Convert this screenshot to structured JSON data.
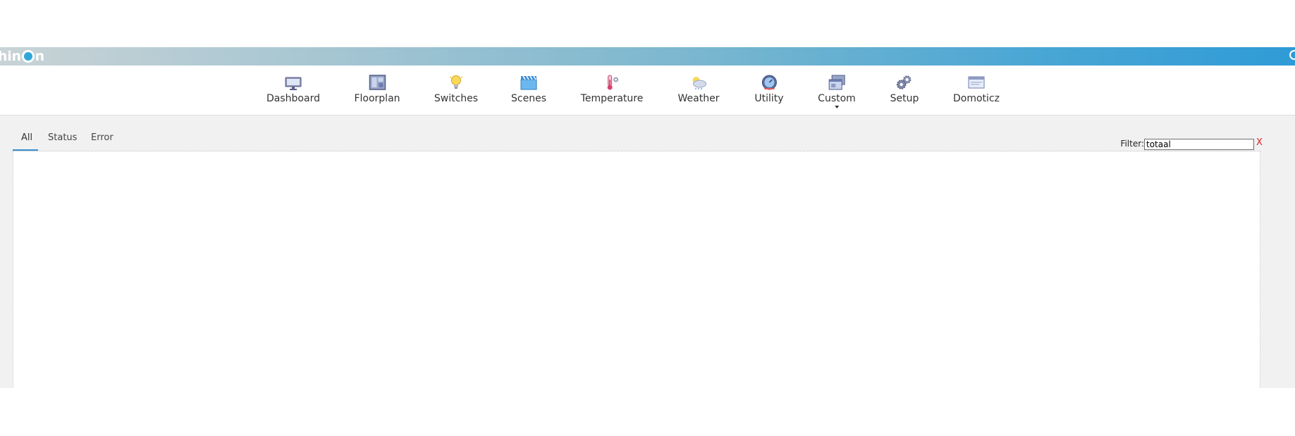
{
  "header": {
    "logo_text_left": "hin",
    "logo_text_right": "n"
  },
  "nav": {
    "items": [
      {
        "label": "Dashboard",
        "icon": "monitor-icon"
      },
      {
        "label": "Floorplan",
        "icon": "floorplan-icon"
      },
      {
        "label": "Switches",
        "icon": "lightbulb-icon"
      },
      {
        "label": "Scenes",
        "icon": "clapperboard-icon"
      },
      {
        "label": "Temperature",
        "icon": "thermometer-icon"
      },
      {
        "label": "Weather",
        "icon": "weather-icon"
      },
      {
        "label": "Utility",
        "icon": "gauge-icon"
      },
      {
        "label": "Custom",
        "icon": "windows-icon"
      },
      {
        "label": "Setup",
        "icon": "gears-icon"
      },
      {
        "label": "Domoticz",
        "icon": "browser-window-icon"
      }
    ]
  },
  "log": {
    "tabs": [
      {
        "label": "All",
        "active": true
      },
      {
        "label": "Status",
        "active": false
      },
      {
        "label": "Error",
        "active": false
      }
    ],
    "filter_label": "Filter:",
    "filter_value": "totaal",
    "clear_label": "X"
  },
  "colors": {
    "banner_start": "#c9d3d6",
    "banner_end": "#2f9bd6",
    "active_tab": "#3b8fd0",
    "clear": "#e02020"
  }
}
